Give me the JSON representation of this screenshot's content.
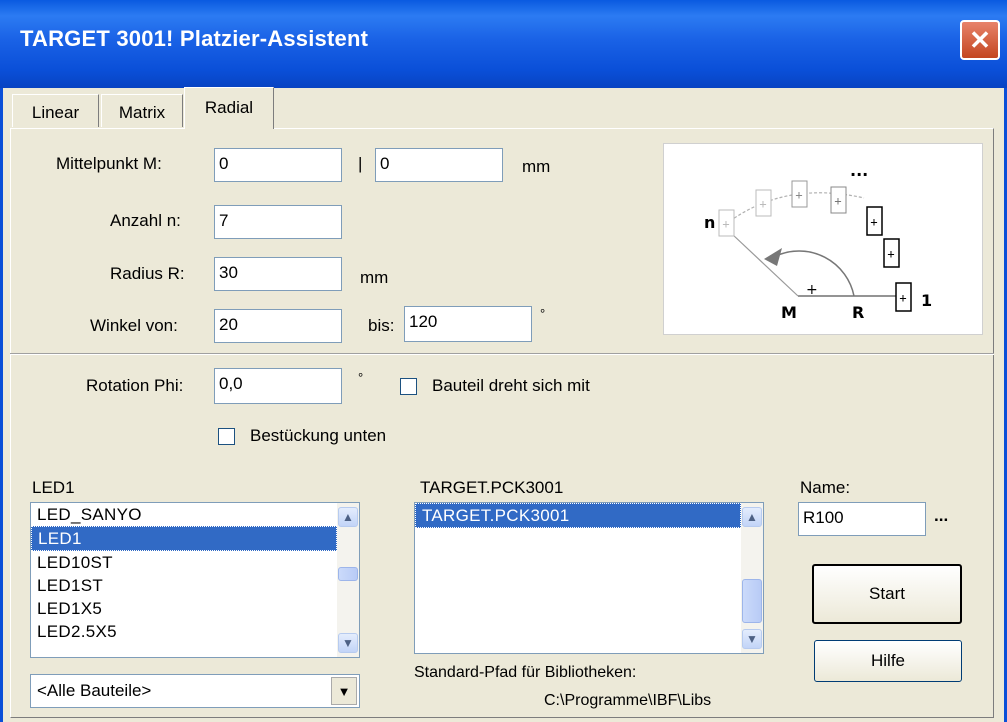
{
  "window": {
    "title": "TARGET 3001! Platzier-Assistent",
    "close_glyph": "✕"
  },
  "tabs": [
    {
      "label": "Linear",
      "active": false
    },
    {
      "label": "Matrix",
      "active": false
    },
    {
      "label": "Radial",
      "active": true
    }
  ],
  "center": {
    "label": "Mittelpunkt  M:",
    "x_value": "0",
    "separator": "|",
    "y_value": "0",
    "unit": "mm"
  },
  "count": {
    "label": "Anzahl  n:",
    "value": "7"
  },
  "radius": {
    "label": "Radius R:",
    "value": "30",
    "unit": "mm"
  },
  "angle": {
    "from_label": "Winkel von:",
    "from_value": "20",
    "to_label": "bis:",
    "to_value": "120",
    "unit": "°"
  },
  "diagram": {
    "label_n": "n",
    "label_m": "M",
    "label_r": "R",
    "label_1": "1",
    "label_dots": "..."
  },
  "rotation": {
    "label": "Rotation Phi:",
    "value": "0,0",
    "unit": "°"
  },
  "rotate_with": {
    "label": "Bauteil dreht sich mit",
    "checked": false
  },
  "bottom_placement": {
    "label": "Bestückung unten",
    "checked": false
  },
  "components": {
    "header": "LED1",
    "items": [
      "LED_SANYO",
      "LED1",
      "LED10ST",
      "LED1ST",
      "LED1X5",
      "LED2.5X5"
    ],
    "selected": "LED1",
    "filter_value": "<Alle Bauteile>"
  },
  "library": {
    "header": "TARGET.PCK3001",
    "items": [
      "TARGET.PCK3001"
    ],
    "selected": "TARGET.PCK3001",
    "path_label": "Standard-Pfad für Bibliotheken:",
    "path_value": "C:\\Programme\\IBF\\Libs"
  },
  "name": {
    "label": "Name:",
    "value": "R100",
    "more": "..."
  },
  "buttons": {
    "start": "Start",
    "help": "Hilfe"
  },
  "icons": {
    "scroll_up": "▲",
    "scroll_down": "▼",
    "dropdown": "▼"
  }
}
